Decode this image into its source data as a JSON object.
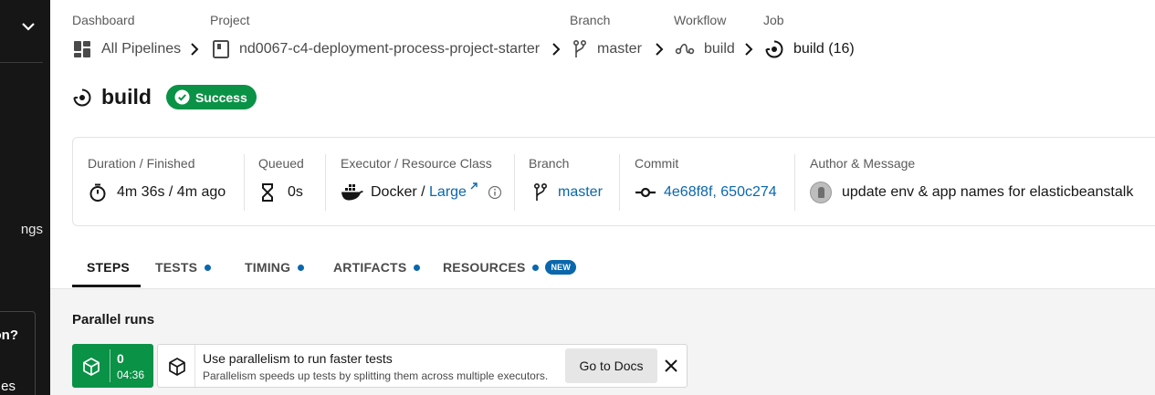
{
  "sidebar": {
    "settings_fragment": "ngs",
    "promo_question_fragment": "on?",
    "promo_text_fragment": "es"
  },
  "breadcrumb": [
    {
      "label": "Dashboard",
      "value": "All Pipelines",
      "icon": "dashboard-icon"
    },
    {
      "label": "Project",
      "value": "nd0067-c4-deployment-process-project-starter",
      "icon": "project-icon"
    },
    {
      "label": "Branch",
      "value": "master",
      "icon": "branch-icon"
    },
    {
      "label": "Workflow",
      "value": "build",
      "icon": "workflow-icon"
    },
    {
      "label": "Job",
      "value": "build (16)",
      "icon": "job-icon"
    }
  ],
  "job": {
    "title": "build",
    "status": "Success",
    "status_color": "#0a9246"
  },
  "info": {
    "duration": {
      "label": "Duration / Finished",
      "value": "4m 36s / 4m ago",
      "icon": "stopwatch-icon"
    },
    "queued": {
      "label": "Queued",
      "value": "0s",
      "icon": "hourglass-icon"
    },
    "executor": {
      "label": "Executor / Resource Class",
      "executor": "Docker",
      "separator": " / ",
      "resource_class": "Large",
      "icon": "docker-icon"
    },
    "branch": {
      "label": "Branch",
      "value": "master",
      "icon": "branch-icon"
    },
    "commit": {
      "label": "Commit",
      "value": "4e68f8f, 650c274",
      "icon": "commit-icon"
    },
    "author": {
      "label": "Author & Message",
      "message": "update env & app names for elasticbeanstalk"
    }
  },
  "tabs": [
    {
      "label": "STEPS",
      "active": true,
      "dot": false
    },
    {
      "label": "TESTS",
      "active": false,
      "dot": true
    },
    {
      "label": "TIMING",
      "active": false,
      "dot": true
    },
    {
      "label": "ARTIFACTS",
      "active": false,
      "dot": true
    },
    {
      "label": "RESOURCES",
      "active": false,
      "dot": true,
      "badge": "NEW"
    }
  ],
  "parallel": {
    "title": "Parallel runs",
    "run_index": "0",
    "run_time": "04:36",
    "tip_title": "Use parallelism to run faster tests",
    "tip_subtitle": "Parallelism speeds up tests by splitting them across multiple executors.",
    "docs_button": "Go to Docs"
  },
  "colors": {
    "accent": "#0a67ac",
    "success": "#0a9246",
    "sidebar_bg": "#161616"
  }
}
